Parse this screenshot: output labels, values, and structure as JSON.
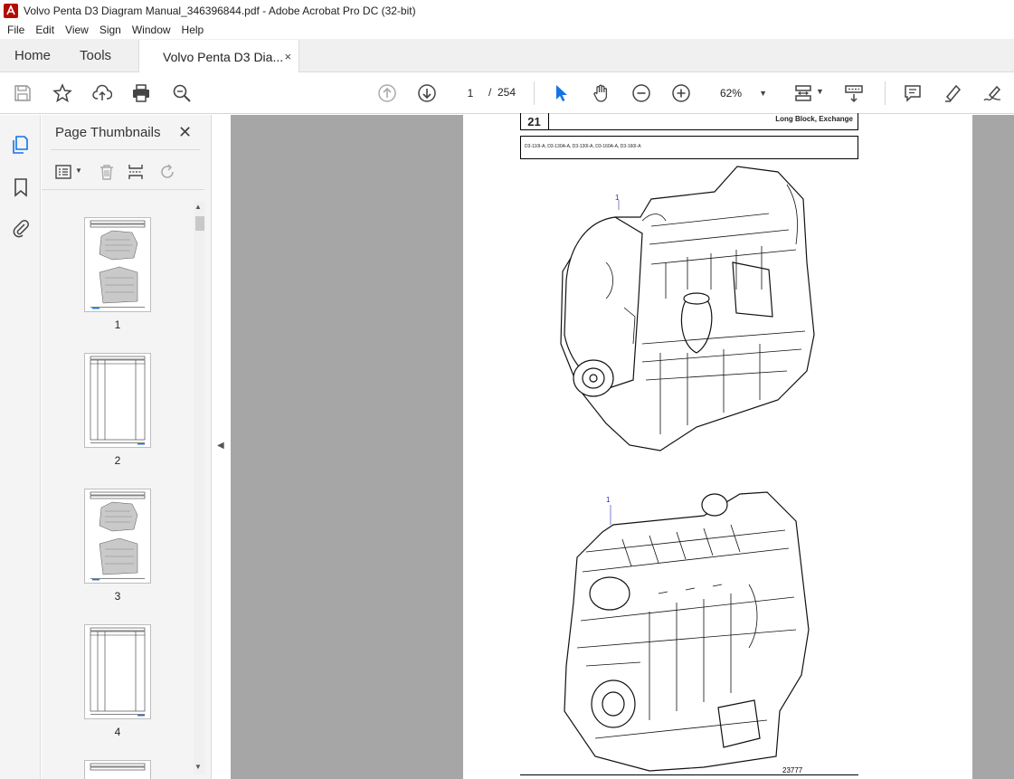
{
  "window": {
    "title": "Volvo Penta D3 Diagram Manual_346396844.pdf - Adobe Acrobat Pro DC (32-bit)"
  },
  "menu": [
    "File",
    "Edit",
    "View",
    "Sign",
    "Window",
    "Help"
  ],
  "tabs": {
    "home": "Home",
    "tools": "Tools",
    "document": "Volvo Penta D3 Dia...",
    "close": "×"
  },
  "toolbar": {
    "current_page": "1",
    "separator": "/",
    "total_pages": "254",
    "zoom": "62%"
  },
  "panel": {
    "title": "Page Thumbnails",
    "close": "✕",
    "thumbnails": [
      "1",
      "2",
      "3",
      "4"
    ]
  },
  "document": {
    "section_number": "21",
    "section_title": "Long Block, Exchange",
    "models": "D3-110I-A, D3-130A-A, D3-130I-A, D3-160A-A, D3-160I-A",
    "callout_top": "1",
    "callout_bottom": "1",
    "figure_number": "23777"
  },
  "colors": {
    "accent": "#1473e6",
    "canvas": "#a6a6a6",
    "callout": "#2a2ab0"
  }
}
